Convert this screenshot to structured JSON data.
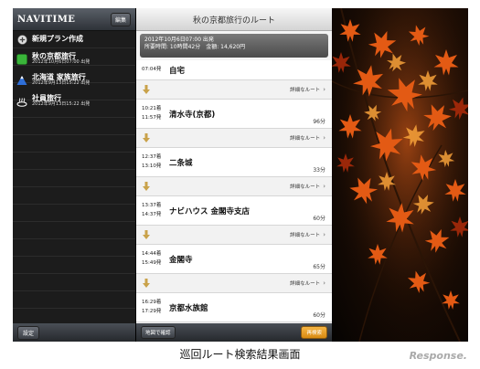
{
  "sidebar": {
    "logo": "NAVITIME",
    "edit_label": "編集",
    "new_plan": "新規プラン作成",
    "items": [
      {
        "title": "秋の京都旅行",
        "sub": "2012年10月6日07:00 出発",
        "icon": "green-square-icon",
        "color": "#3ab53a"
      },
      {
        "title": "北海道 家族旅行",
        "sub": "2012年9月13日15:22 出発",
        "icon": "mountain-icon",
        "color": "#2f6fd8"
      },
      {
        "title": "社員旅行",
        "sub": "2012年9月13日15:22 出発",
        "icon": "hot-spring-icon",
        "color": "#ffffff"
      }
    ],
    "settings_label": "設定"
  },
  "route": {
    "title": "秋の京都旅行のルート",
    "summary_line1": "2012年10月6日07:00 出発",
    "summary_line2": "所要時間: 10時間42分　金額: 14,620円",
    "detail_label": "詳細なルート",
    "stops": [
      {
        "arrive": "",
        "depart": "07:04発",
        "name": "自宅",
        "duration": ""
      },
      {
        "arrive": "10:21着",
        "depart": "11:57発",
        "name": "清水寺(京都)",
        "duration": "96分"
      },
      {
        "arrive": "12:37着",
        "depart": "13:10発",
        "name": "二条城",
        "duration": "33分"
      },
      {
        "arrive": "13:37着",
        "depart": "14:37発",
        "name": "ナビハウス 金閣寺支店",
        "duration": "60分"
      },
      {
        "arrive": "14:44着",
        "depart": "15:49発",
        "name": "金閣寺",
        "duration": "65分"
      },
      {
        "arrive": "16:29着",
        "depart": "17:29発",
        "name": "京都水族館",
        "duration": "60分"
      }
    ],
    "map_button": "地図で確認",
    "research_button": "再検索"
  },
  "caption": "巡回ルート検索結果画面",
  "brand": "Response.",
  "colors": {
    "accent_orange": "#e8a02a",
    "arrow": "#c9a24a"
  }
}
